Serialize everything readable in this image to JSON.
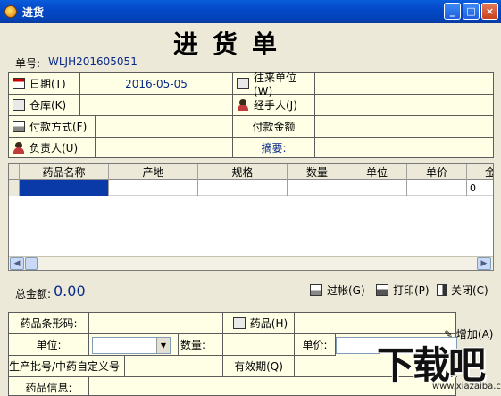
{
  "window": {
    "title": "进货",
    "controls": [
      "_",
      "□",
      "×"
    ]
  },
  "document": {
    "title": "进货单",
    "number_label": "单号:",
    "number": "WLJH201605051"
  },
  "header": {
    "date_label": "日期(T)",
    "date_value": "2016-05-05",
    "partner_label": "往来单位(W)",
    "warehouse_label": "仓库(K)",
    "handler_label": "经手人(J)",
    "payment_method_label": "付款方式(F)",
    "payment_amount_label": "付款金额",
    "responsible_label": "负责人(U)",
    "summary_label": "摘要:"
  },
  "table": {
    "columns": [
      "药品名称",
      "产地",
      "规格",
      "数量",
      "单位",
      "单价",
      "金"
    ],
    "rows": [
      {
        "amount": "0"
      }
    ]
  },
  "summary": {
    "total_label": "总金额:",
    "total_value": "0.00",
    "post_button": "过帐(G)",
    "print_button": "打印(P)",
    "close_button": "关闭(C)"
  },
  "form": {
    "barcode_label": "药品条形码:",
    "drug_label": "药品(H)",
    "unit_label": "单位:",
    "quantity_label": "数量:",
    "price_label": "单价:",
    "batch_label": "生产批号/中药自定义号",
    "expiry_label": "有效期(Q)",
    "drug_info_label": "药品信息:",
    "add_button": "增加(A)"
  },
  "watermark": {
    "text": "下载吧",
    "url": "www.xiazaiba.com"
  },
  "colors": {
    "titlebar": "#0348c8",
    "form_bg": "#ffffe6",
    "value_text": "#0a2a8a",
    "selected_cell": "#0a3aa8"
  }
}
